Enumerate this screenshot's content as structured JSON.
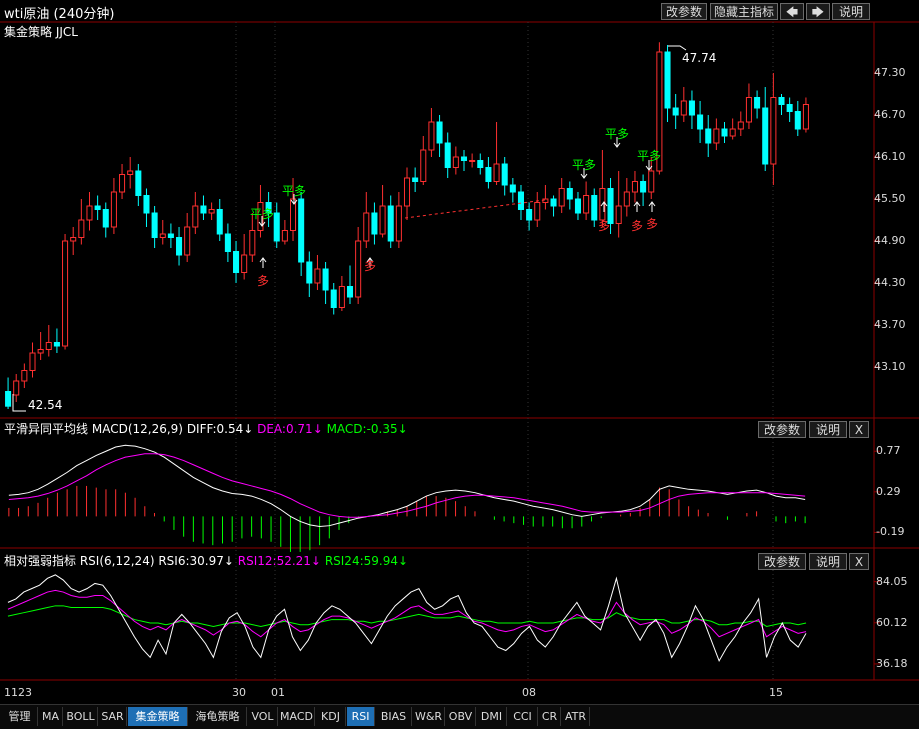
{
  "window": {
    "title": "wti原油 (240分钟)"
  },
  "toolbar": {
    "change_params": "改参数",
    "hide_main_indicator": "隐藏主指标",
    "left_arrow": "🡄",
    "right_arrow": "🡆",
    "explain": "说明"
  },
  "main_panel": {
    "indicator_name": "集金策略 JJCL",
    "y_ticks": [
      "47.30",
      "46.70",
      "46.10",
      "45.50",
      "44.90",
      "44.30",
      "43.70",
      "43.10"
    ],
    "high_label": "47.74",
    "low_label": "42.54",
    "signal_buy": "多",
    "signal_flat_buy": "平多"
  },
  "macd_panel": {
    "name": "平滑异同平均线",
    "params": "MACD(12,26,9)",
    "diff": "DIFF:0.54↓",
    "dea": "DEA:0.71↓",
    "macd": "MACD:-0.35↓",
    "y_ticks": [
      "0.77",
      "0.29",
      "-0.19"
    ],
    "change_params": "改参数",
    "explain": "说明",
    "close": "X"
  },
  "rsi_panel": {
    "name": "相对强弱指标",
    "params": "RSI(6,12,24)",
    "rsi6": "RSI6:30.97↓",
    "rsi12": "RSI12:52.21↓",
    "rsi24": "RSI24:59.94↓",
    "y_ticks": [
      "84.05",
      "60.12",
      "36.18"
    ],
    "change_params": "改参数",
    "explain": "说明",
    "close": "X"
  },
  "x_axis": {
    "labels": [
      "1123",
      "30",
      "01",
      "08",
      "15"
    ]
  },
  "tabs": [
    "管理",
    "MA",
    "BOLL",
    "SAR",
    "集金策略",
    "海龟策略",
    "VOL",
    "MACD",
    "KDJ",
    "RSI",
    "BIAS",
    "W&R",
    "OBV",
    "DMI",
    "CCI",
    "CR",
    "ATR"
  ],
  "active_tabs": [
    "集金策略",
    "RSI"
  ],
  "colors": {
    "up": "#ff3030",
    "down": "#00ffff",
    "signal_green": "#00ff00",
    "diff": "#ffffff",
    "dea": "#ff00ff",
    "rsi6": "#ffffff",
    "rsi12": "#ff00ff",
    "rsi24": "#00ff00",
    "grid": "#8b0000"
  },
  "chart_data": [
    {
      "type": "candlestick",
      "title": "wti原油 (240分钟)",
      "ylim": [
        42.4,
        48.0
      ],
      "candles": [
        [
          42.75,
          42.54,
          42.95,
          42.5
        ],
        [
          42.7,
          42.9,
          43.0,
          42.6
        ],
        [
          42.9,
          43.05,
          43.15,
          42.8
        ],
        [
          43.05,
          43.3,
          43.45,
          42.95
        ],
        [
          43.3,
          43.35,
          43.6,
          43.2
        ],
        [
          43.35,
          43.45,
          43.7,
          43.25
        ],
        [
          43.45,
          43.4,
          43.65,
          43.3
        ],
        [
          43.4,
          44.9,
          45.0,
          43.35
        ],
        [
          44.9,
          44.95,
          45.1,
          44.7
        ],
        [
          44.95,
          45.2,
          45.5,
          44.85
        ],
        [
          45.2,
          45.4,
          45.6,
          45.05
        ],
        [
          45.4,
          45.35,
          45.55,
          45.2
        ],
        [
          45.35,
          45.1,
          45.45,
          44.95
        ],
        [
          45.1,
          45.6,
          45.8,
          45.0
        ],
        [
          45.6,
          45.85,
          46.0,
          45.5
        ],
        [
          45.85,
          45.9,
          46.1,
          45.65
        ],
        [
          45.9,
          45.55,
          46.0,
          45.4
        ],
        [
          45.55,
          45.3,
          45.65,
          45.1
        ],
        [
          45.3,
          44.95,
          45.4,
          44.8
        ],
        [
          44.95,
          45.0,
          45.2,
          44.85
        ],
        [
          45.0,
          44.95,
          45.15,
          44.8
        ],
        [
          44.95,
          44.7,
          45.1,
          44.55
        ],
        [
          44.7,
          45.1,
          45.3,
          44.6
        ],
        [
          45.1,
          45.4,
          45.6,
          45.0
        ],
        [
          45.4,
          45.3,
          45.55,
          45.2
        ],
        [
          45.3,
          45.35,
          45.45,
          45.2
        ],
        [
          45.35,
          45.0,
          45.5,
          44.9
        ],
        [
          45.0,
          44.75,
          45.15,
          44.6
        ],
        [
          44.75,
          44.45,
          44.9,
          44.3
        ],
        [
          44.45,
          44.7,
          45.0,
          44.35
        ],
        [
          44.7,
          45.05,
          45.3,
          44.6
        ],
        [
          45.05,
          45.45,
          45.7,
          44.95
        ],
        [
          45.45,
          45.3,
          45.6,
          45.1
        ],
        [
          45.3,
          44.9,
          45.45,
          44.8
        ],
        [
          44.9,
          45.05,
          45.2,
          44.85
        ],
        [
          45.05,
          45.5,
          45.8,
          44.9
        ],
        [
          45.5,
          44.6,
          45.6,
          44.4
        ],
        [
          44.6,
          44.3,
          44.75,
          44.1
        ],
        [
          44.3,
          44.5,
          44.7,
          44.2
        ],
        [
          44.5,
          44.2,
          44.6,
          44.0
        ],
        [
          44.2,
          43.95,
          44.3,
          43.85
        ],
        [
          43.95,
          44.25,
          44.4,
          43.9
        ],
        [
          44.25,
          44.1,
          44.55,
          44.0
        ],
        [
          44.1,
          44.9,
          45.1,
          44.0
        ],
        [
          44.9,
          45.3,
          45.6,
          44.8
        ],
        [
          45.3,
          45.0,
          45.45,
          44.85
        ],
        [
          45.0,
          45.4,
          45.7,
          44.95
        ],
        [
          45.4,
          44.9,
          45.55,
          44.8
        ],
        [
          44.9,
          45.4,
          45.6,
          44.8
        ],
        [
          45.4,
          45.8,
          45.95,
          45.2
        ],
        [
          45.8,
          45.75,
          45.95,
          45.6
        ],
        [
          45.75,
          46.2,
          46.4,
          45.7
        ],
        [
          46.2,
          46.6,
          46.8,
          46.1
        ],
        [
          46.6,
          46.3,
          46.7,
          46.1
        ],
        [
          46.3,
          45.95,
          46.45,
          45.8
        ],
        [
          45.95,
          46.1,
          46.25,
          45.85
        ],
        [
          46.1,
          46.05,
          46.2,
          45.9
        ],
        [
          46.05,
          46.05,
          46.15,
          45.95
        ],
        [
          46.05,
          45.95,
          46.15,
          45.85
        ],
        [
          45.95,
          45.75,
          46.1,
          45.65
        ],
        [
          45.75,
          46.0,
          46.6,
          45.7
        ],
        [
          46.0,
          45.7,
          46.1,
          45.55
        ],
        [
          45.7,
          45.6,
          45.8,
          45.45
        ],
        [
          45.6,
          45.35,
          45.7,
          45.2
        ],
        [
          45.35,
          45.2,
          45.45,
          45.05
        ],
        [
          45.2,
          45.45,
          45.6,
          45.1
        ],
        [
          45.45,
          45.5,
          45.7,
          45.35
        ],
        [
          45.5,
          45.4,
          45.55,
          45.25
        ],
        [
          45.4,
          45.65,
          45.8,
          45.3
        ],
        [
          45.65,
          45.5,
          45.75,
          45.35
        ],
        [
          45.5,
          45.3,
          45.6,
          45.2
        ],
        [
          45.3,
          45.55,
          45.75,
          45.2
        ],
        [
          45.55,
          45.2,
          45.65,
          45.1
        ],
        [
          45.2,
          45.65,
          46.2,
          45.1
        ],
        [
          45.65,
          45.15,
          45.8,
          45.0
        ],
        [
          45.15,
          45.4,
          45.9,
          44.95
        ],
        [
          45.4,
          45.6,
          45.8,
          45.25
        ],
        [
          45.6,
          45.75,
          45.9,
          45.45
        ],
        [
          45.75,
          45.6,
          45.85,
          45.4
        ],
        [
          45.6,
          45.9,
          46.1,
          45.5
        ],
        [
          45.9,
          47.6,
          47.74,
          45.85
        ],
        [
          47.6,
          46.8,
          47.7,
          46.6
        ],
        [
          46.8,
          46.7,
          47.0,
          46.5
        ],
        [
          46.7,
          46.9,
          47.1,
          46.6
        ],
        [
          46.9,
          46.7,
          47.05,
          46.5
        ],
        [
          46.7,
          46.5,
          46.9,
          46.3
        ],
        [
          46.5,
          46.3,
          46.7,
          46.1
        ],
        [
          46.3,
          46.5,
          46.65,
          46.2
        ],
        [
          46.5,
          46.4,
          46.6,
          46.3
        ],
        [
          46.4,
          46.5,
          46.65,
          46.35
        ],
        [
          46.5,
          46.6,
          46.75,
          46.4
        ],
        [
          46.6,
          46.95,
          47.15,
          46.5
        ],
        [
          46.95,
          46.8,
          47.05,
          46.65
        ],
        [
          46.8,
          46.0,
          47.1,
          45.9
        ],
        [
          46.0,
          46.95,
          47.3,
          45.7
        ],
        [
          46.95,
          46.85,
          47.0,
          46.7
        ],
        [
          46.85,
          46.75,
          46.95,
          46.6
        ],
        [
          46.75,
          46.5,
          46.9,
          46.4
        ],
        [
          46.5,
          46.85,
          46.95,
          46.45
        ]
      ],
      "annotations": [
        "47.74",
        "42.54",
        "平多",
        "多"
      ]
    },
    {
      "type": "line",
      "title": "平滑异同平均线 MACD(12,26,9)",
      "ylim": [
        -0.35,
        0.95
      ],
      "series": [
        {
          "name": "DIFF",
          "values": [
            0.25,
            0.26,
            0.28,
            0.32,
            0.38,
            0.45,
            0.52,
            0.6,
            0.66,
            0.72,
            0.77,
            0.82,
            0.84,
            0.83,
            0.8,
            0.76,
            0.7,
            0.62,
            0.54,
            0.46,
            0.4,
            0.34,
            0.3,
            0.27,
            0.26,
            0.24,
            0.2,
            0.15,
            0.08,
            0.0,
            -0.06,
            -0.1,
            -0.12,
            -0.11,
            -0.08,
            -0.05,
            -0.02,
            0.0,
            0.02,
            0.05,
            0.08,
            0.12,
            0.18,
            0.24,
            0.28,
            0.3,
            0.31,
            0.3,
            0.28,
            0.25,
            0.22,
            0.2,
            0.18,
            0.15,
            0.12,
            0.1,
            0.08,
            0.05,
            0.02,
            0.0,
            0.02,
            0.04,
            0.05,
            0.06,
            0.08,
            0.12,
            0.2,
            0.32,
            0.36,
            0.34,
            0.32,
            0.31,
            0.3,
            0.28,
            0.26,
            0.28,
            0.3,
            0.31,
            0.28,
            0.24,
            0.22,
            0.22,
            0.2
          ]
        },
        {
          "name": "DEA",
          "values": [
            0.2,
            0.21,
            0.22,
            0.24,
            0.27,
            0.31,
            0.36,
            0.42,
            0.48,
            0.55,
            0.61,
            0.66,
            0.7,
            0.72,
            0.74,
            0.74,
            0.73,
            0.7,
            0.66,
            0.61,
            0.56,
            0.51,
            0.46,
            0.42,
            0.39,
            0.36,
            0.33,
            0.3,
            0.26,
            0.21,
            0.15,
            0.1,
            0.05,
            0.02,
            0.0,
            -0.01,
            -0.01,
            0.0,
            0.01,
            0.02,
            0.04,
            0.06,
            0.09,
            0.12,
            0.16,
            0.19,
            0.22,
            0.24,
            0.25,
            0.25,
            0.24,
            0.23,
            0.22,
            0.2,
            0.18,
            0.16,
            0.14,
            0.12,
            0.09,
            0.06,
            0.05,
            0.05,
            0.05,
            0.05,
            0.06,
            0.07,
            0.1,
            0.15,
            0.2,
            0.24,
            0.26,
            0.27,
            0.28,
            0.28,
            0.28,
            0.28,
            0.28,
            0.28,
            0.28,
            0.27,
            0.26,
            0.25,
            0.24
          ]
        }
      ]
    },
    {
      "type": "line",
      "title": "相对强弱指标 RSI(6,12,24)",
      "ylim": [
        28,
        92
      ],
      "series": [
        {
          "name": "RSI6",
          "values": [
            72,
            74,
            78,
            80,
            82,
            86,
            88,
            85,
            80,
            78,
            80,
            83,
            82,
            76,
            68,
            60,
            52,
            45,
            40,
            50,
            42,
            60,
            65,
            60,
            54,
            48,
            40,
            55,
            63,
            66,
            58,
            46,
            40,
            56,
            64,
            68,
            52,
            44,
            50,
            60,
            66,
            70,
            68,
            64,
            60,
            54,
            48,
            56,
            64,
            70,
            74,
            78,
            80,
            72,
            68,
            70,
            74,
            76,
            66,
            60,
            58,
            52,
            46,
            44,
            48,
            54,
            58,
            50,
            46,
            52,
            60,
            66,
            72,
            64,
            60,
            56,
            70,
            86,
            66,
            58,
            50,
            58,
            62,
            54,
            40,
            48,
            58,
            70,
            62,
            50,
            38,
            46,
            52,
            60,
            66,
            74,
            40,
            52,
            60,
            50,
            46,
            54
          ]
        },
        {
          "name": "RSI12",
          "values": [
            68,
            70,
            72,
            74,
            76,
            78,
            79,
            78,
            76,
            75,
            75,
            76,
            76,
            73,
            69,
            65,
            61,
            58,
            56,
            58,
            56,
            60,
            62,
            60,
            58,
            56,
            53,
            56,
            60,
            61,
            59,
            55,
            52,
            56,
            60,
            62,
            58,
            55,
            56,
            59,
            62,
            64,
            64,
            63,
            61,
            59,
            57,
            59,
            61,
            63,
            66,
            69,
            70,
            67,
            65,
            65,
            66,
            67,
            64,
            61,
            60,
            58,
            56,
            55,
            56,
            58,
            59,
            57,
            55,
            56,
            59,
            62,
            65,
            63,
            61,
            60,
            64,
            72,
            66,
            62,
            59,
            60,
            61,
            59,
            54,
            56,
            59,
            63,
            61,
            57,
            52,
            54,
            56,
            58,
            60,
            62,
            52,
            55,
            58,
            56,
            54,
            55
          ]
        },
        {
          "name": "RSI24",
          "values": [
            64,
            65,
            66,
            67,
            68,
            69,
            70,
            70,
            69,
            69,
            69,
            69,
            69,
            68,
            66,
            64,
            62,
            61,
            60,
            60,
            59,
            60,
            61,
            60,
            60,
            59,
            58,
            59,
            60,
            60,
            60,
            59,
            58,
            59,
            60,
            61,
            60,
            59,
            59,
            60,
            61,
            62,
            62,
            62,
            61,
            61,
            60,
            61,
            61,
            62,
            63,
            64,
            65,
            64,
            63,
            63,
            63,
            64,
            63,
            62,
            61,
            61,
            60,
            60,
            60,
            60,
            61,
            60,
            60,
            60,
            61,
            62,
            63,
            63,
            62,
            62,
            63,
            66,
            64,
            63,
            62,
            62,
            62,
            62,
            60,
            60,
            61,
            62,
            62,
            61,
            59,
            59,
            60,
            60,
            61,
            61,
            58,
            59,
            60,
            60,
            59,
            60
          ]
        }
      ]
    }
  ]
}
